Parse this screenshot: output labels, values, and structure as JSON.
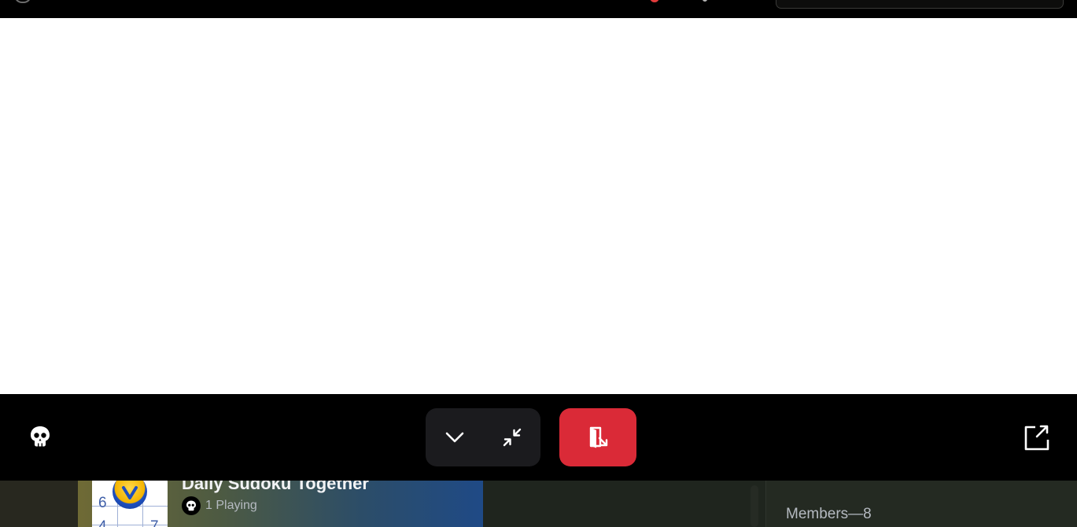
{
  "control_bar": {
    "participant_icon": "skull-icon",
    "collapse_icon": "chevron-down-icon",
    "minimize_icon": "minimize-arrows-icon",
    "leave_icon": "leave-activity-icon",
    "popout_icon": "popout-icon"
  },
  "activity_card": {
    "title": "Daily Sudoku Together",
    "players": "1 Playing",
    "thumbnail_digits": [
      "6",
      "4",
      "7"
    ]
  },
  "members": {
    "header": "Members—8"
  },
  "colors": {
    "leave_button": "#da2a37",
    "control_group": "#1b1b1e",
    "activity_canvas": "#ffffff"
  }
}
